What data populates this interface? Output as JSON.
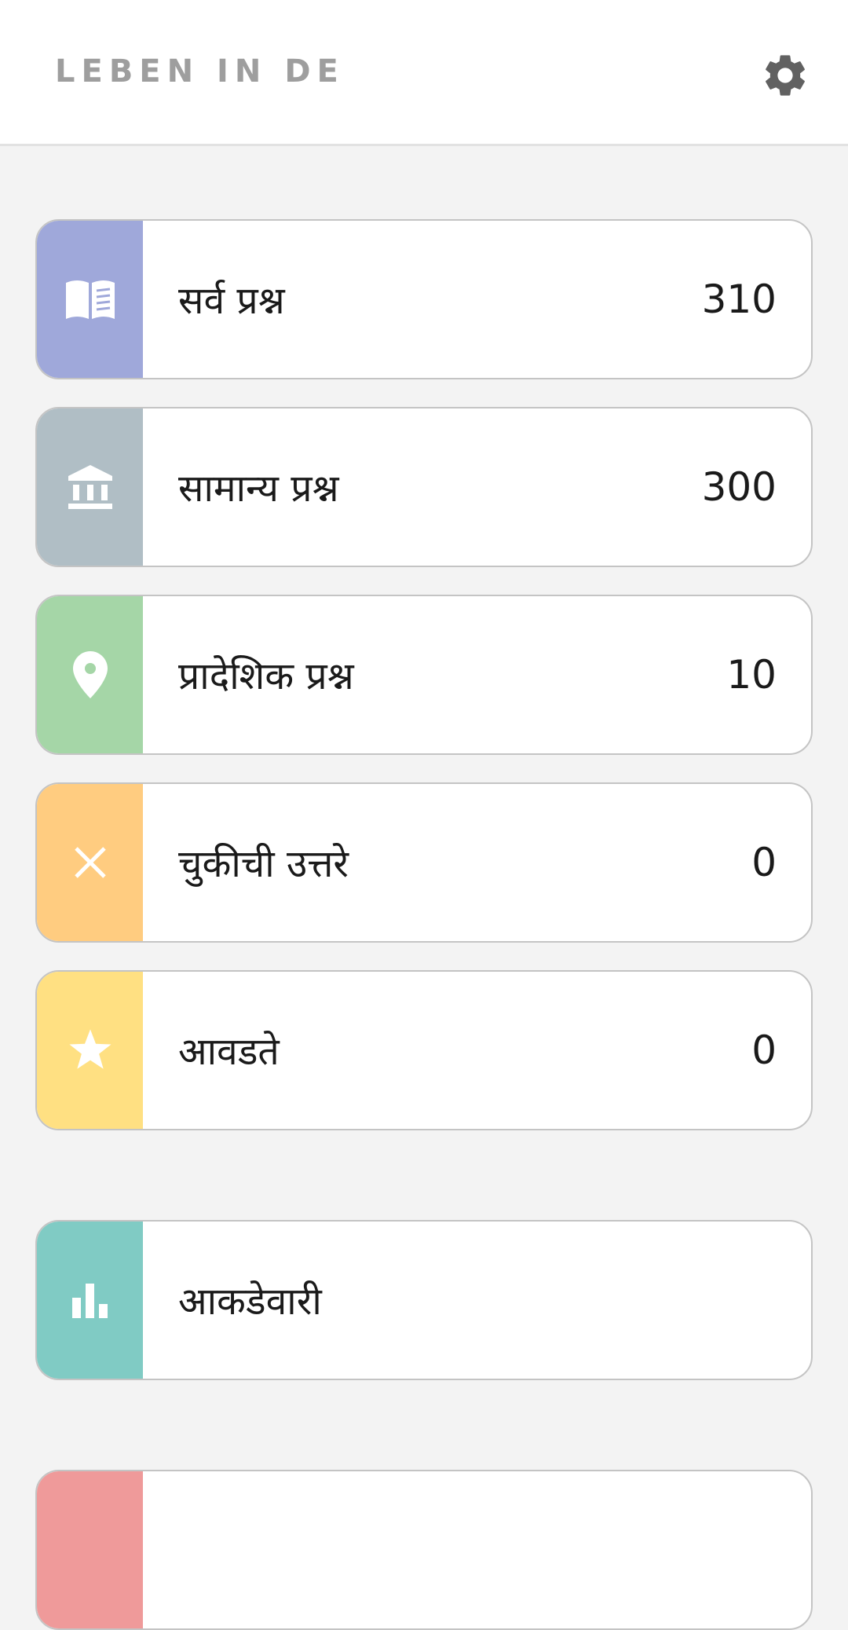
{
  "header": {
    "title": "LEBEN IN DE",
    "settings_icon": "gear-icon"
  },
  "menu": {
    "all": {
      "label": "सर्व प्रश्न",
      "count": "310",
      "color": "#9fa8da",
      "icon": "book-icon"
    },
    "general": {
      "label": "सामान्य प्रश्न",
      "count": "300",
      "color": "#b0bec5",
      "icon": "bank-icon"
    },
    "regional": {
      "label": "प्रादेशिक प्रश्न",
      "count": "10",
      "color": "#a5d6a7",
      "icon": "location-pin-icon"
    },
    "wrong": {
      "label": "चुकीची उत्तरे",
      "count": "0",
      "color": "#ffcc80",
      "icon": "close-icon"
    },
    "favorites": {
      "label": "आवडते",
      "count": "0",
      "color": "#ffe082",
      "icon": "star-icon"
    },
    "statistics": {
      "label": "आकडेवारी",
      "color": "#80cbc4",
      "icon": "bar-chart-icon"
    },
    "next_item": {
      "color": "#ef9a9a"
    }
  }
}
